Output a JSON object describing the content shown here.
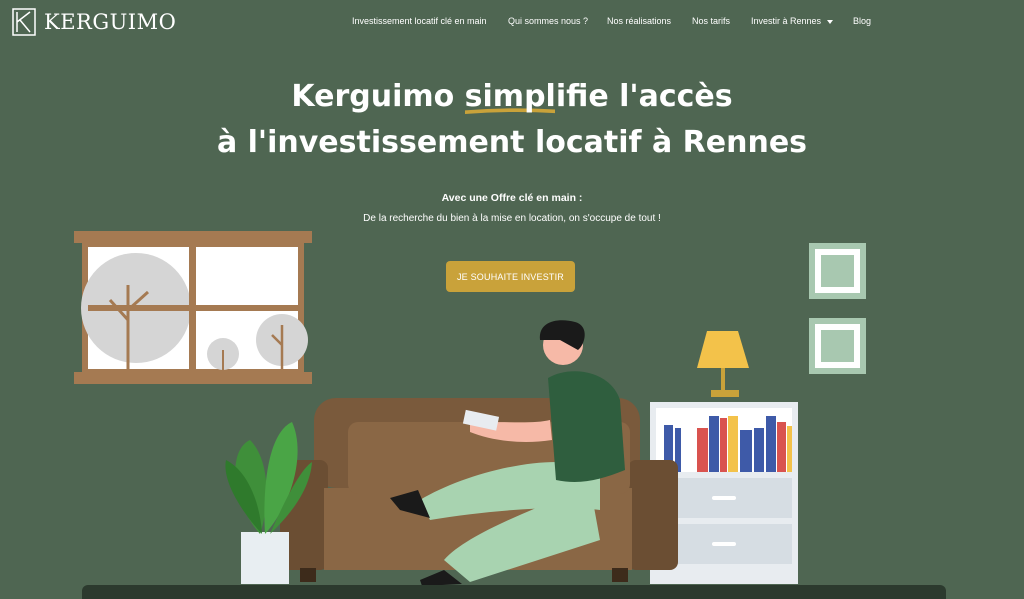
{
  "brand": {
    "name": "KERGUIMO"
  },
  "nav": {
    "items": [
      {
        "label": "Investissement locatif clé en main"
      },
      {
        "label": "Qui sommes nous ?"
      },
      {
        "label": "Nos réalisations"
      },
      {
        "label": "Nos tarifs"
      },
      {
        "label": "Investir à Rennes"
      },
      {
        "label": "Blog"
      }
    ]
  },
  "hero": {
    "title_part1": "Kerguimo ",
    "title_highlight": "simplifie l'accès",
    "title_line2": "à l'investissement locatif à Rennes",
    "subtitle": "Avec une Offre clé en main :",
    "description": "De la recherche du bien à la mise en location, on s'occupe de tout !",
    "cta_label": "JE SOUHAITE INVESTIR"
  },
  "colors": {
    "background": "#4f6652",
    "accent": "#c9a23a",
    "sofa": "#7a5a3c",
    "shirt": "#2f5e3e"
  }
}
